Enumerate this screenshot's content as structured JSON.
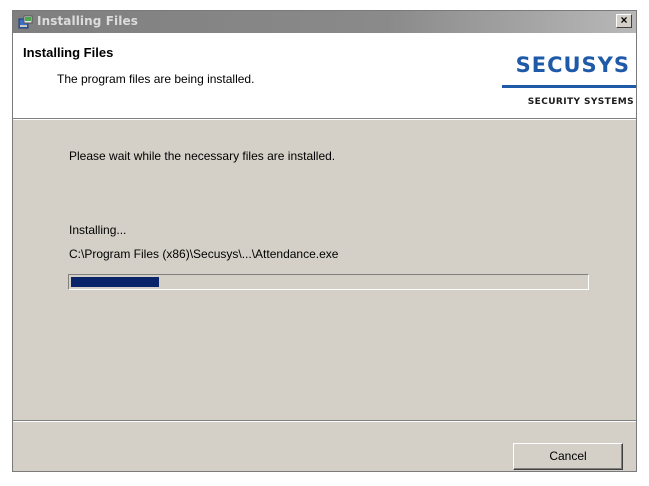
{
  "window": {
    "title": "Installing Files",
    "close_glyph": "×"
  },
  "header": {
    "title": "Installing Files",
    "subtitle": "The program files are being installed.",
    "logo": {
      "main": "SECUSYS",
      "sub": "SECURITY SYSTEMS",
      "color": "#1e5aa8"
    }
  },
  "body": {
    "wait_message": "Please wait while the necessary files are installed.",
    "status": "Installing...",
    "current_file": "C:\\Program Files (x86)\\Secusys\\...\\Attendance.exe",
    "progress_fraction": 0.17,
    "progress_color": "#0a246a"
  },
  "buttons": {
    "cancel": "Cancel"
  },
  "icons": {
    "app": "installer-icon",
    "close": "close-icon"
  }
}
